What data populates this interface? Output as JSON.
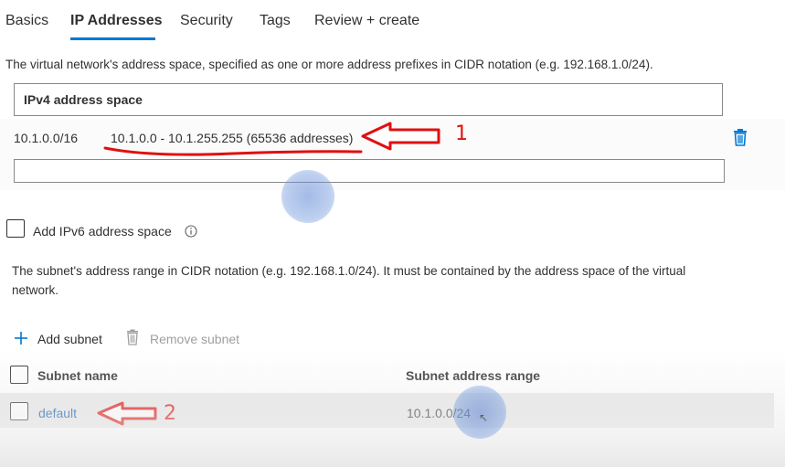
{
  "tabs": [
    {
      "label": "Basics",
      "active": false
    },
    {
      "label": "IP Addresses",
      "active": true
    },
    {
      "label": "Security",
      "active": false
    },
    {
      "label": "Tags",
      "active": false
    },
    {
      "label": "Review + create",
      "active": false
    }
  ],
  "ipv4": {
    "description": "The virtual network's address space, specified as one or more address prefixes in CIDR notation (e.g. 192.168.1.0/24).",
    "header": "IPv4 address space",
    "entry_value": "10.1.0.0/16",
    "entry_range": "10.1.0.0 - 10.1.255.255 (65536 addresses)",
    "new_input_value": ""
  },
  "ipv6": {
    "checkbox_label": "Add IPv6 address space",
    "checked": false
  },
  "subnets": {
    "description_line1": "The subnet's address range in CIDR notation (e.g. 192.168.1.0/24). It must be contained by the address space of the virtual",
    "description_line2": "network.",
    "add_label": "Add subnet",
    "remove_label": "Remove subnet",
    "columns": [
      "Subnet name",
      "Subnet address range"
    ],
    "rows": [
      {
        "name": "default",
        "range": "10.1.0.0/24"
      }
    ]
  },
  "annotations": {
    "marker1": "1",
    "marker2": "2",
    "color": "#e01010"
  },
  "colors": {
    "accent": "#0078d4",
    "link": "#0b58a7",
    "annotation": "#e01010"
  },
  "icons": [
    "info-icon",
    "trash-icon",
    "plus-icon",
    "arrow-left-icon"
  ]
}
